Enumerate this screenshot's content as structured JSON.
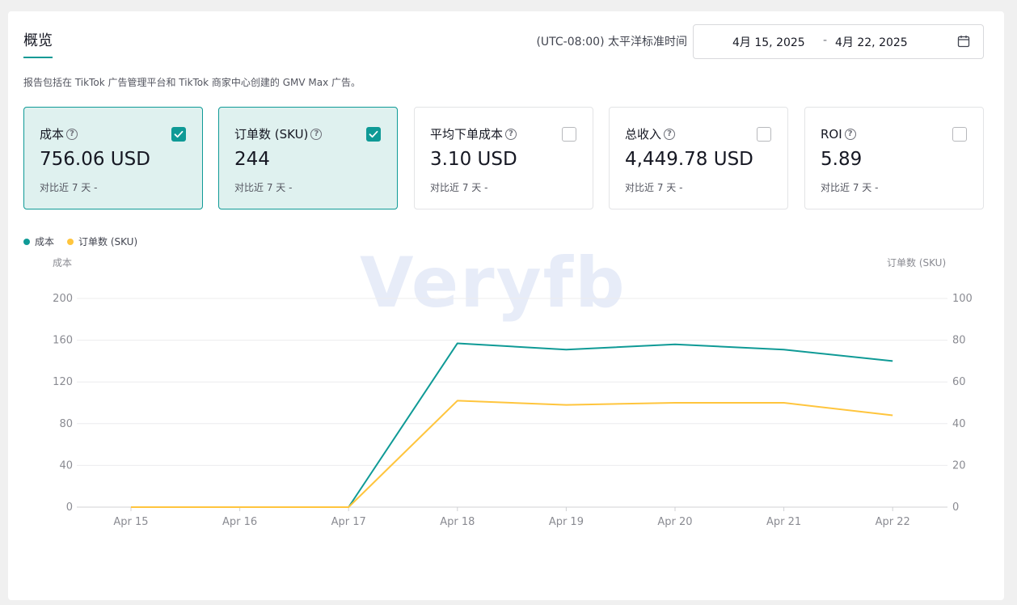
{
  "header": {
    "tab_title": "概览",
    "timezone": "(UTC-08:00) 太平洋标准时间",
    "date_start": "4月 15, 2025",
    "date_separator": "-",
    "date_end": "4月 22, 2025"
  },
  "note": "报告包括在 TikTok 广告管理平台和 TikTok 商家中心创建的 GMV Max 广告。",
  "cards": [
    {
      "label": "成本",
      "value": "756.06 USD",
      "compare": "对比近 7 天 -",
      "checked": true
    },
    {
      "label": "订单数 (SKU)",
      "value": "244",
      "compare": "对比近 7 天 -",
      "checked": true
    },
    {
      "label": "平均下单成本",
      "value": "3.10 USD",
      "compare": "对比近 7 天 -",
      "checked": false
    },
    {
      "label": "总收入",
      "value": "4,449.78 USD",
      "compare": "对比近 7 天 -",
      "checked": false
    },
    {
      "label": "ROI",
      "value": "5.89",
      "compare": "对比近 7 天 -",
      "checked": false
    }
  ],
  "watermark": "Veryfb",
  "colors": {
    "accent": "#0f9a96",
    "series_cost": "#0f9a96",
    "series_orders": "#ffc53d"
  },
  "chart_data": {
    "type": "line",
    "x": [
      "Apr 15",
      "Apr 16",
      "Apr 17",
      "Apr 18",
      "Apr 19",
      "Apr 20",
      "Apr 21",
      "Apr 22"
    ],
    "y_left_label": "成本",
    "y_right_label": "订单数 (SKU)",
    "y_left_ticks": [
      0,
      40,
      80,
      120,
      160,
      200
    ],
    "y_right_ticks": [
      0,
      20,
      40,
      60,
      80,
      100
    ],
    "ylim_left": [
      0,
      200
    ],
    "ylim_right": [
      0,
      100
    ],
    "grid": true,
    "legend_position": "top-left",
    "series": [
      {
        "name": "成本",
        "axis": "left",
        "color": "#0f9a96",
        "values": [
          0,
          0,
          0,
          157,
          151,
          156,
          151,
          140
        ]
      },
      {
        "name": "订单数 (SKU)",
        "axis": "right",
        "color": "#ffc53d",
        "values": [
          0,
          0,
          0,
          51,
          49,
          50,
          50,
          44
        ]
      }
    ]
  }
}
